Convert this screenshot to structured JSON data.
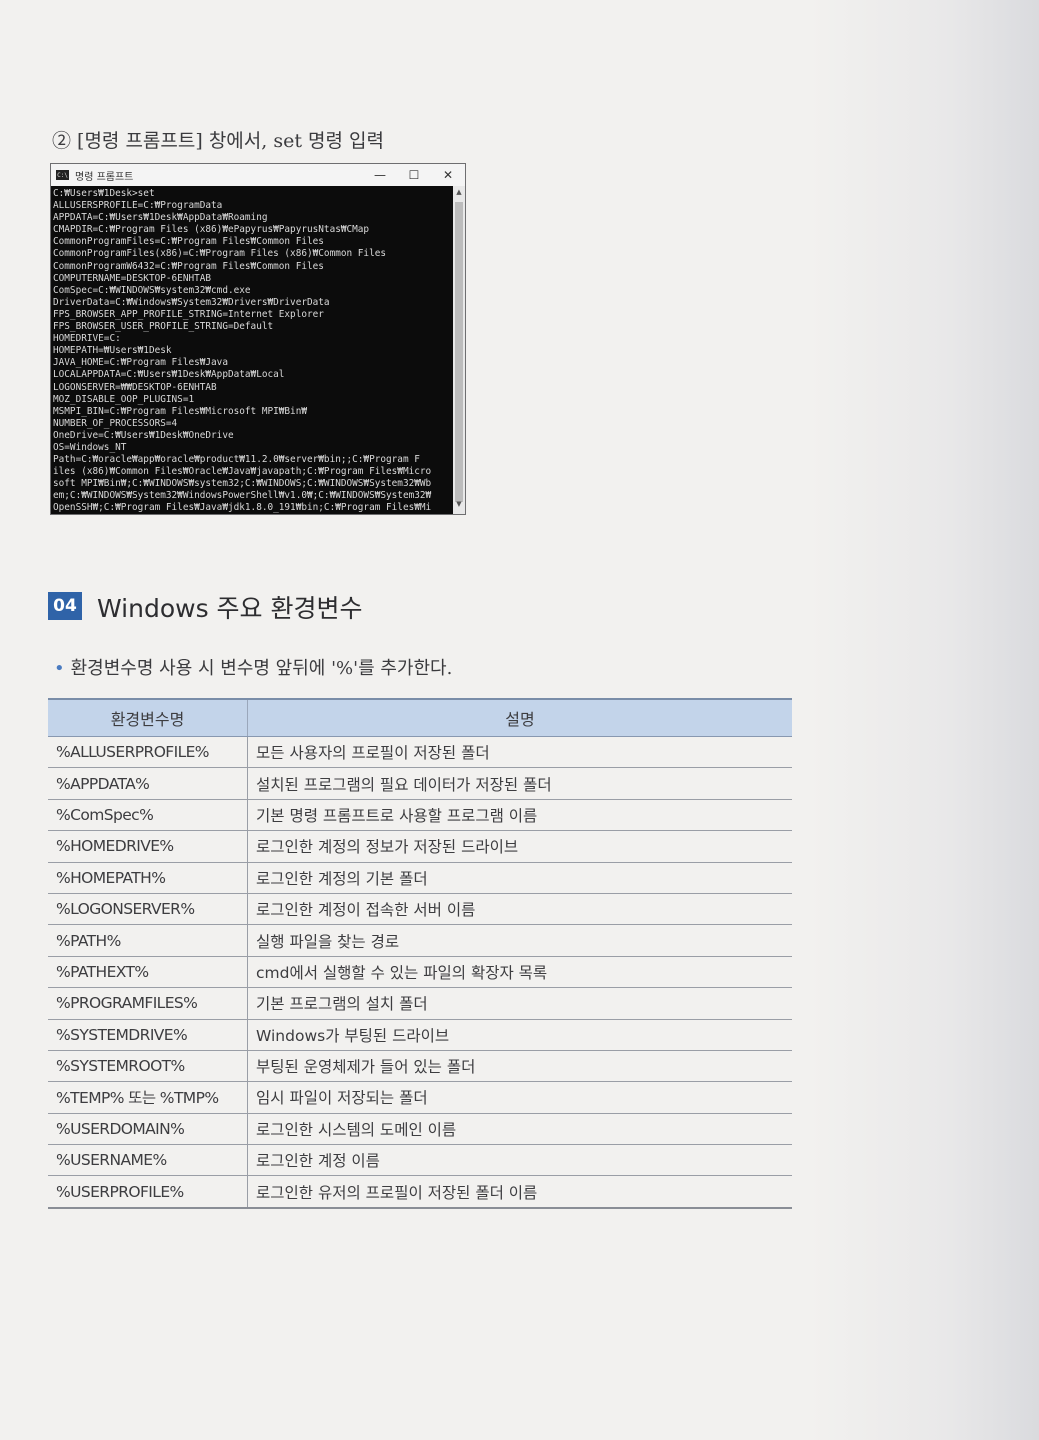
{
  "step": "② [명령 프롬프트] 창에서, set 명령 입력",
  "cmd": {
    "icon_text": "C:\\",
    "title": "명령 프롬프트",
    "controls": {
      "minimize": "—",
      "maximize": "☐",
      "close": "✕"
    },
    "lines": [
      "C:₩Users₩1Desk>set",
      "ALLUSERSPROFILE=C:₩ProgramData",
      "APPDATA=C:₩Users₩1Desk₩AppData₩Roaming",
      "CMAPDIR=C:₩Program Files (x86)₩ePapyrus₩PapyrusNtas₩CMap",
      "CommonProgramFiles=C:₩Program Files₩Common Files",
      "CommonProgramFiles(x86)=C:₩Program Files (x86)₩Common Files",
      "CommonProgramW6432=C:₩Program Files₩Common Files",
      "COMPUTERNAME=DESKTOP-6ENHTAB",
      "ComSpec=C:₩WINDOWS₩system32₩cmd.exe",
      "DriverData=C:₩Windows₩System32₩Drivers₩DriverData",
      "FPS_BROWSER_APP_PROFILE_STRING=Internet Explorer",
      "FPS_BROWSER_USER_PROFILE_STRING=Default",
      "HOMEDRIVE=C:",
      "HOMEPATH=₩Users₩1Desk",
      "JAVA_HOME=C:₩Program Files₩Java",
      "LOCALAPPDATA=C:₩Users₩1Desk₩AppData₩Local",
      "LOGONSERVER=₩₩DESKTOP-6ENHTAB",
      "MOZ_DISABLE_OOP_PLUGINS=1",
      "MSMPI_BIN=C:₩Program Files₩Microsoft MPI₩Bin₩",
      "NUMBER_OF_PROCESSORS=4",
      "OneDrive=C:₩Users₩1Desk₩OneDrive",
      "OS=Windows_NT",
      "Path=C:₩oracle₩app₩oracle₩product₩11.2.0₩server₩bin;;C:₩Program F",
      "iles (x86)₩Common Files₩Oracle₩Java₩javapath;C:₩Program Files₩Micro",
      "soft MPI₩Bin₩;C:₩WINDOWS₩system32;C:₩WINDOWS;C:₩WINDOWS₩System32₩Wb",
      "em;C:₩WINDOWS₩System32₩WindowsPowerShell₩v1.0₩;C:₩WINDOWS₩System32₩",
      "OpenSSH₩;C:₩Program Files₩Java₩jdk1.8.0_191₩bin;C:₩Program Files₩Mi"
    ]
  },
  "section": {
    "number": "04",
    "title": "Windows 주요 환경변수",
    "bullet": "환경변수명 사용 시 변수명 앞뒤에 '%'를 추가한다."
  },
  "table": {
    "headers": [
      "환경변수명",
      "설명"
    ],
    "rows": [
      [
        "%ALLUSERPROFILE%",
        "모든 사용자의 프로필이 저장된 폴더"
      ],
      [
        "%APPDATA%",
        "설치된 프로그램의 필요 데이터가 저장된 폴더"
      ],
      [
        "%ComSpec%",
        "기본 명령 프롬프트로 사용할 프로그램 이름"
      ],
      [
        "%HOMEDRIVE%",
        "로그인한 계정의 정보가 저장된 드라이브"
      ],
      [
        "%HOMEPATH%",
        "로그인한 계정의 기본 폴더"
      ],
      [
        "%LOGONSERVER%",
        "로그인한 계정이 접속한 서버 이름"
      ],
      [
        "%PATH%",
        "실행 파일을 찾는 경로"
      ],
      [
        "%PATHEXT%",
        "cmd에서 실행할 수 있는 파일의 확장자 목록"
      ],
      [
        "%PROGRAMFILES%",
        "기본 프로그램의 설치 폴더"
      ],
      [
        "%SYSTEMDRIVE%",
        "Windows가 부팅된 드라이브"
      ],
      [
        "%SYSTEMROOT%",
        "부팅된 운영체제가 들어 있는 폴더"
      ],
      [
        "%TEMP% 또는 %TMP%",
        "임시 파일이 저장되는 폴더"
      ],
      [
        "%USERDOMAIN%",
        "로그인한 시스템의 도메인 이름"
      ],
      [
        "%USERNAME%",
        "로그인한 계정 이름"
      ],
      [
        "%USERPROFILE%",
        "로그인한 유저의 프로필이 저장된 폴더 이름"
      ]
    ]
  }
}
